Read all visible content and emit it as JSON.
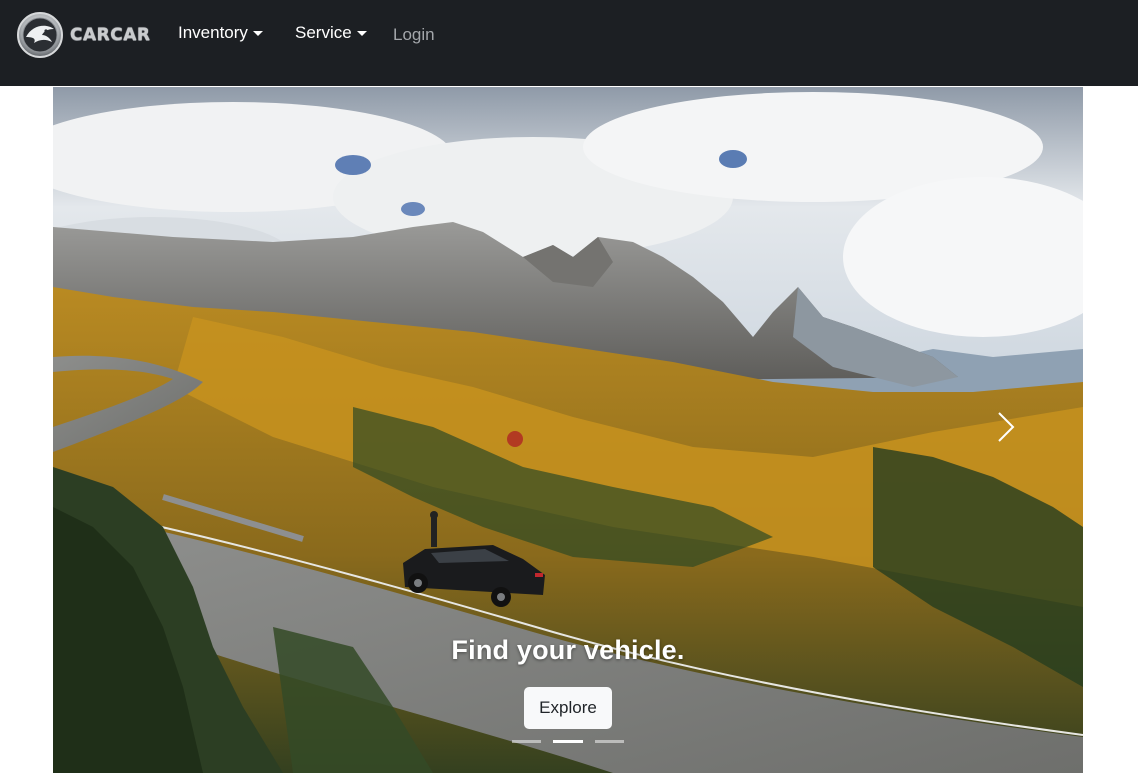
{
  "navbar": {
    "brand_text": "CARCAR",
    "items": [
      {
        "label": "Inventory",
        "has_dropdown": true
      },
      {
        "label": "Service",
        "has_dropdown": true
      },
      {
        "label": "Login",
        "has_dropdown": false
      }
    ],
    "background_color": "#1c1f23"
  },
  "carousel": {
    "caption_title": "Find your vehicle.",
    "button_label": "Explore",
    "prev_icon": "chevron-left-icon",
    "next_icon": "chevron-right-icon",
    "slide_count": 3,
    "active_slide_index": 1
  }
}
